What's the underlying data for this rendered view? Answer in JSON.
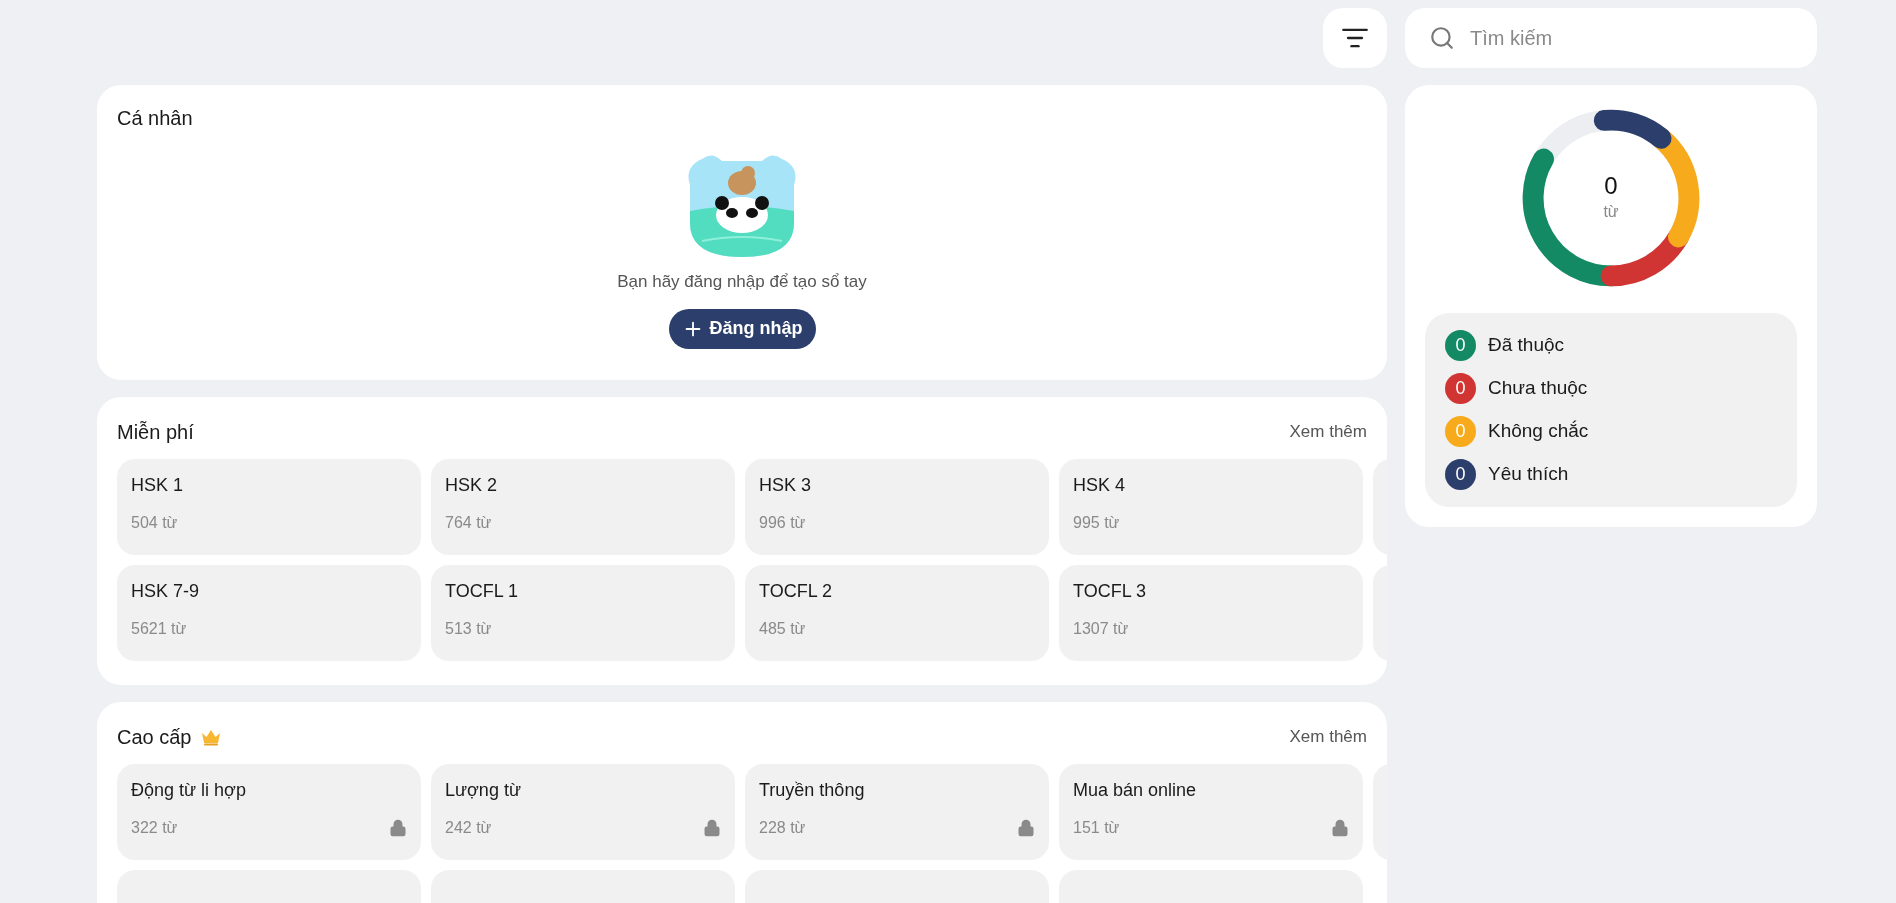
{
  "toolbar": {
    "search": {
      "placeholder": "Tìm kiếm"
    }
  },
  "personal": {
    "title": "Cá nhân",
    "message": "Bạn hãy đăng nhập để tạo sổ tay",
    "login_button": "Đăng nhập"
  },
  "sections": [
    {
      "title": "Miễn phí",
      "premium": false,
      "more": "Xem thêm",
      "items": [
        {
          "name": "HSK 1",
          "count": "504 từ",
          "locked": false
        },
        {
          "name": "HSK 2",
          "count": "764 từ",
          "locked": false
        },
        {
          "name": "HSK 3",
          "count": "996 từ",
          "locked": false
        },
        {
          "name": "HSK 4",
          "count": "995 từ",
          "locked": false
        },
        {
          "name": "HSK 7-9",
          "count": "5621 từ",
          "locked": false
        },
        {
          "name": "TOCFL 1",
          "count": "513 từ",
          "locked": false
        },
        {
          "name": "TOCFL 2",
          "count": "485 từ",
          "locked": false
        },
        {
          "name": "TOCFL 3",
          "count": "1307 từ",
          "locked": false
        }
      ]
    },
    {
      "title": "Cao cấp",
      "premium": true,
      "more": "Xem thêm",
      "items": [
        {
          "name": "Động từ li hợp",
          "count": "322 từ",
          "locked": true
        },
        {
          "name": "Lượng từ",
          "count": "242 từ",
          "locked": true
        },
        {
          "name": "Truyền thông",
          "count": "228 từ",
          "locked": true
        },
        {
          "name": "Mua bán online",
          "count": "151 từ",
          "locked": true
        }
      ]
    }
  ],
  "stats": {
    "total": "0",
    "unit": "từ",
    "legend": [
      {
        "count": "0",
        "label": "Đã thuộc",
        "color": "#138a63"
      },
      {
        "count": "0",
        "label": "Chưa thuộc",
        "color": "#d03533"
      },
      {
        "count": "0",
        "label": "Không chắc",
        "color": "#f7ab1c"
      },
      {
        "count": "0",
        "label": "Yêu thích",
        "color": "#2c3e6b"
      }
    ]
  }
}
